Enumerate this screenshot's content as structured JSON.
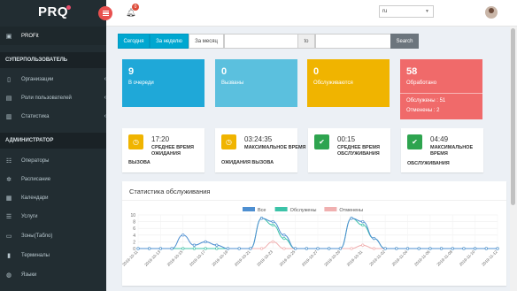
{
  "app": {
    "logo_letters": "PR",
    "logo_q": "Q"
  },
  "sidebar": {
    "active_item": "PROFit",
    "sections": [
      {
        "header": "СУПЕРПОЛЬЗОВАТЕЛЬ",
        "items": [
          "Организации",
          "Роли пользователей",
          "Статистика"
        ]
      },
      {
        "header": "АДМИНИСТРАТОР",
        "items": [
          "Операторы",
          "Расписание",
          "Календари",
          "Услуги",
          "Зоны(Табло)",
          "Терминалы",
          "Языки"
        ]
      }
    ]
  },
  "topbar": {
    "notifications_count": "0",
    "language": "ru"
  },
  "filter": {
    "today": "Сегодня",
    "week": "За неделю",
    "month": "За месяц",
    "to_label": "to",
    "search": "Search"
  },
  "stats": [
    {
      "value": "9",
      "label": "В очереди",
      "color": "#1fa8d8"
    },
    {
      "value": "0",
      "label": "Вызваны",
      "color": "#5bc0de"
    },
    {
      "value": "0",
      "label": "Обслуживаются",
      "color": "#f0b400"
    },
    {
      "value": "58",
      "label": "Обработано",
      "color": "#f06a6a",
      "served": "Обслужены : 51",
      "cancelled": "Отменены : 2"
    }
  ],
  "cards": [
    {
      "value": "17:20",
      "caption1": "СРЕДНЕЕ ВРЕМЯ ОЖИДАНИЯ",
      "caption2": "ВЫЗОВА",
      "icon": "clock-icon",
      "color": "#f0b400"
    },
    {
      "value": "03:24:35",
      "caption1": "МАКСИМАЛЬНОЕ ВРЕМЯ",
      "caption2": "ОЖИДАНИЯ ВЫЗОВА",
      "icon": "clock-icon",
      "color": "#f0b400"
    },
    {
      "value": "00:15",
      "caption1": "СРЕДНЕЕ ВРЕМЯ ОБСЛУЖИВАНИЯ",
      "caption2": "",
      "icon": "check-icon",
      "color": "#2ea44f"
    },
    {
      "value": "04:49",
      "caption1": "МАКСИМАЛЬНОЕ ВРЕМЯ",
      "caption2": "ОБСЛУЖИВАНИЯ",
      "icon": "check-icon",
      "color": "#2ea44f"
    }
  ],
  "chart": {
    "title": "Статистика обслуживания"
  },
  "chart_data": {
    "type": "line",
    "ylim": [
      0,
      10
    ],
    "yticks": [
      0,
      2,
      4,
      6,
      8,
      10
    ],
    "x": [
      "2019-10-11",
      "2019-10-12",
      "2019-10-13",
      "2019-10-14",
      "2019-10-15",
      "2019-10-16",
      "2019-10-17",
      "2019-10-18",
      "2019-10-19",
      "2019-10-20",
      "2019-10-21",
      "2019-10-22",
      "2019-10-23",
      "2019-10-24",
      "2019-10-25",
      "2019-10-26",
      "2019-10-27",
      "2019-10-28",
      "2019-10-29",
      "2019-10-30",
      "2019-10-31",
      "2019-11-01",
      "2019-11-02",
      "2019-11-03",
      "2019-11-04",
      "2019-11-05",
      "2019-11-06",
      "2019-11-07",
      "2019-11-08",
      "2019-11-09",
      "2019-11-10",
      "2019-11-11",
      "2019-11-12"
    ],
    "xticks": [
      "2019-10-11",
      "2019-10-13",
      "2019-10-15",
      "2019-10-17",
      "2019-10-19",
      "2019-10-21",
      "2019-10-23",
      "2019-10-25",
      "2019-10-27",
      "2019-10-29",
      "2019-10-31",
      "2019-11-02",
      "2019-11-04",
      "2019-11-06",
      "2019-11-08",
      "2019-11-10",
      "2019-11-12"
    ],
    "series": [
      {
        "name": "Все",
        "color": "#4e8fd1",
        "values": [
          0,
          0,
          0,
          0,
          4,
          1,
          2,
          1,
          0,
          0,
          0,
          9,
          8,
          4,
          0,
          0,
          0,
          0,
          0,
          9,
          8,
          3,
          0,
          0,
          0,
          0,
          0,
          0,
          0,
          0,
          0,
          0,
          0
        ]
      },
      {
        "name": "Обслужены",
        "color": "#3cc3a8",
        "values": [
          0,
          0,
          0,
          0,
          0,
          0,
          0,
          0,
          0,
          0,
          0,
          9,
          7,
          3,
          0,
          0,
          0,
          0,
          0,
          9,
          7,
          3,
          0,
          0,
          0,
          0,
          0,
          0,
          0,
          0,
          0,
          0,
          0
        ]
      },
      {
        "name": "Отменены",
        "color": "#f0b0b0",
        "values": [
          0,
          0,
          0,
          0,
          0,
          0,
          0,
          0,
          0,
          0,
          0,
          0,
          2,
          0,
          0,
          0,
          0,
          0,
          0,
          0,
          1,
          0,
          0,
          0,
          0,
          0,
          0,
          0,
          0,
          0,
          0,
          0,
          0
        ]
      }
    ]
  }
}
